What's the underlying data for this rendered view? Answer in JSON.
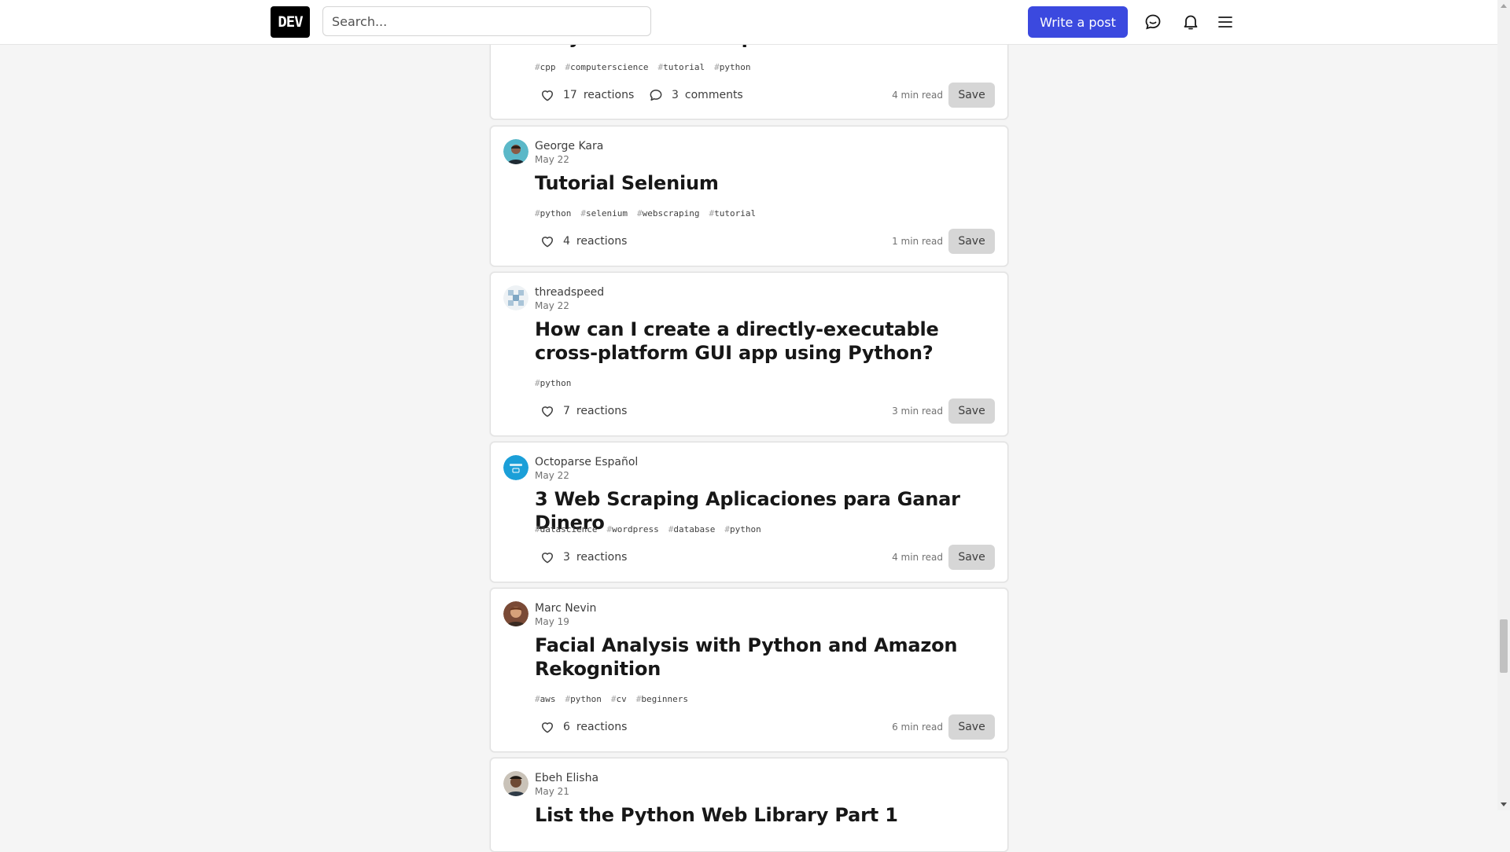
{
  "header": {
    "logo_text": "DEV",
    "search_placeholder": "Search...",
    "write_post_label": "Write a post"
  },
  "colors": {
    "accent": "#3b49df",
    "background": "#f5f5f5",
    "card": "#ffffff"
  },
  "posts": [
    {
      "author": "",
      "date": "",
      "title": "Why Not C Hash Map?",
      "tags": [
        "cpp",
        "computerscience",
        "tutorial",
        "python"
      ],
      "reactions": "17",
      "reactions_label": "reactions",
      "comments": "3",
      "comments_label": "comments",
      "read_time": "4 min read",
      "save_label": "Save"
    },
    {
      "author": "George Kara",
      "date": "May 22",
      "title": "Tutorial Selenium",
      "tags": [
        "python",
        "selenium",
        "webscraping",
        "tutorial"
      ],
      "reactions": "4",
      "reactions_label": "reactions",
      "read_time": "1 min read",
      "save_label": "Save"
    },
    {
      "author": "threadspeed",
      "date": "May 22",
      "title": "How can I create a directly-executable cross-platform GUI app using Python?",
      "tags": [
        "python"
      ],
      "reactions": "7",
      "reactions_label": "reactions",
      "read_time": "3 min read",
      "save_label": "Save"
    },
    {
      "author": "Octoparse Español",
      "date": "May 22",
      "title": "3 Web Scraping Aplicaciones para Ganar Dinero",
      "tags": [
        "datascience",
        "wordpress",
        "database",
        "python"
      ],
      "reactions": "3",
      "reactions_label": "reactions",
      "read_time": "4 min read",
      "save_label": "Save"
    },
    {
      "author": "Marc Nevin",
      "date": "May 19",
      "title": "Facial Analysis with Python and Amazon Rekognition",
      "tags": [
        "aws",
        "python",
        "cv",
        "beginners"
      ],
      "reactions": "6",
      "reactions_label": "reactions",
      "read_time": "6 min read",
      "save_label": "Save"
    },
    {
      "author": "Ebeh Elisha",
      "date": "May 21",
      "title": "List the Python Web Library Part 1"
    }
  ]
}
